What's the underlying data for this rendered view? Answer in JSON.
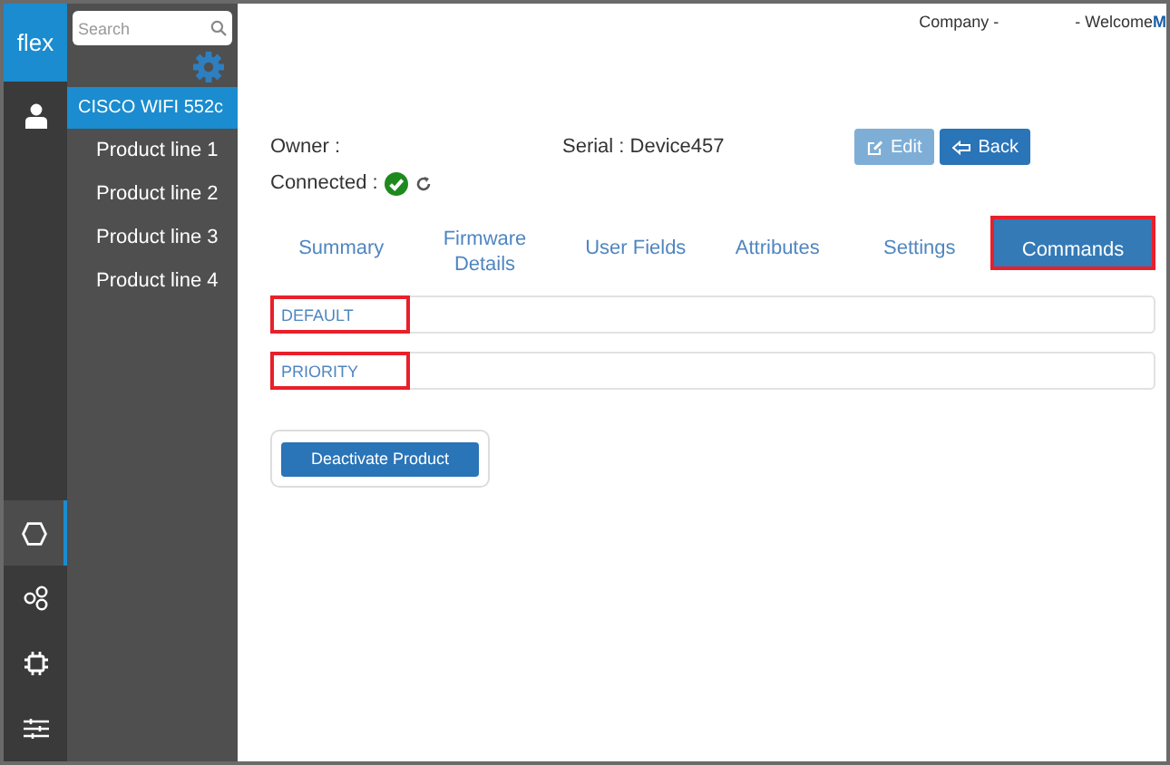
{
  "rail": {
    "logo": "flex",
    "items": [
      {
        "kind": "user",
        "selected": false
      },
      {
        "kind": "hexagon",
        "selected": true
      },
      {
        "kind": "nodes",
        "selected": false
      },
      {
        "kind": "chip",
        "selected": false
      },
      {
        "kind": "sliders",
        "selected": false
      }
    ]
  },
  "sidebar": {
    "search": {
      "placeholder": "Search"
    },
    "items": [
      {
        "label": "CISCO WIFI 552c",
        "selected": true
      },
      {
        "label": "Product line 1",
        "selected": false
      },
      {
        "label": "Product line 2",
        "selected": false
      },
      {
        "label": "Product line 3",
        "selected": false
      },
      {
        "label": "Product line 4",
        "selected": false
      }
    ]
  },
  "header": {
    "company": "Company -",
    "welcome": "- Welcome",
    "user": "M"
  },
  "device": {
    "owner": "Owner :",
    "serial": "Serial : Device457",
    "connected": "Connected :",
    "online": true
  },
  "buttons": [
    {
      "label": "Edit",
      "kind": "edit",
      "disabled": true
    },
    {
      "label": "Back",
      "kind": "back",
      "disabled": false
    }
  ],
  "tabs": [
    {
      "label": "Summary",
      "selected": false,
      "highlighted": false
    },
    {
      "label": "Firmware Details",
      "selected": false,
      "highlighted": false
    },
    {
      "label": "User Fields",
      "selected": false,
      "highlighted": false
    },
    {
      "label": "Attributes",
      "selected": false,
      "highlighted": false
    },
    {
      "label": "Settings",
      "selected": false,
      "highlighted": false
    },
    {
      "label": "Commands",
      "selected": true,
      "highlighted": true
    }
  ],
  "command_groups": [
    {
      "label": "DEFAULT",
      "highlighted": true
    },
    {
      "label": "PRIORITY",
      "highlighted": true
    }
  ],
  "action": {
    "label": "Deactivate Product"
  }
}
